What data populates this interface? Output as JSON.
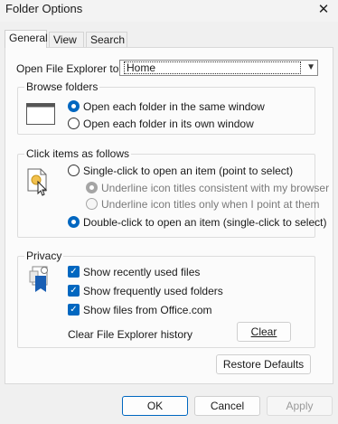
{
  "window": {
    "title": "Folder Options",
    "close_glyph": "✕"
  },
  "tabs": [
    {
      "label": "General"
    },
    {
      "label": "View"
    },
    {
      "label": "Search"
    }
  ],
  "open_explorer": {
    "label": "Open File Explorer to:",
    "value": "Home"
  },
  "browse": {
    "title": "Browse folders",
    "options": [
      {
        "label": "Open each folder in the same window",
        "selected": true
      },
      {
        "label": "Open each folder in its own window",
        "selected": false
      }
    ]
  },
  "click": {
    "title": "Click items as follows",
    "single": "Single-click to open an item (point to select)",
    "sub1": "Underline icon titles consistent with my browser",
    "sub2": "Underline icon titles only when I point at them",
    "double": "Double-click to open an item (single-click to select)"
  },
  "privacy": {
    "title": "Privacy",
    "checks": [
      {
        "label": "Show recently used files",
        "checked": true
      },
      {
        "label": "Show frequently used folders",
        "checked": true
      },
      {
        "label": "Show files from Office.com",
        "checked": true
      }
    ],
    "clear_label": "Clear File Explorer history",
    "clear_button": "Clear"
  },
  "restore_button": "Restore Defaults",
  "footer": {
    "ok": "OK",
    "cancel": "Cancel",
    "apply": "Apply"
  },
  "colors": {
    "accent": "#0067c0",
    "panel": "#fbfbfb",
    "window": "#f0f0f0"
  }
}
